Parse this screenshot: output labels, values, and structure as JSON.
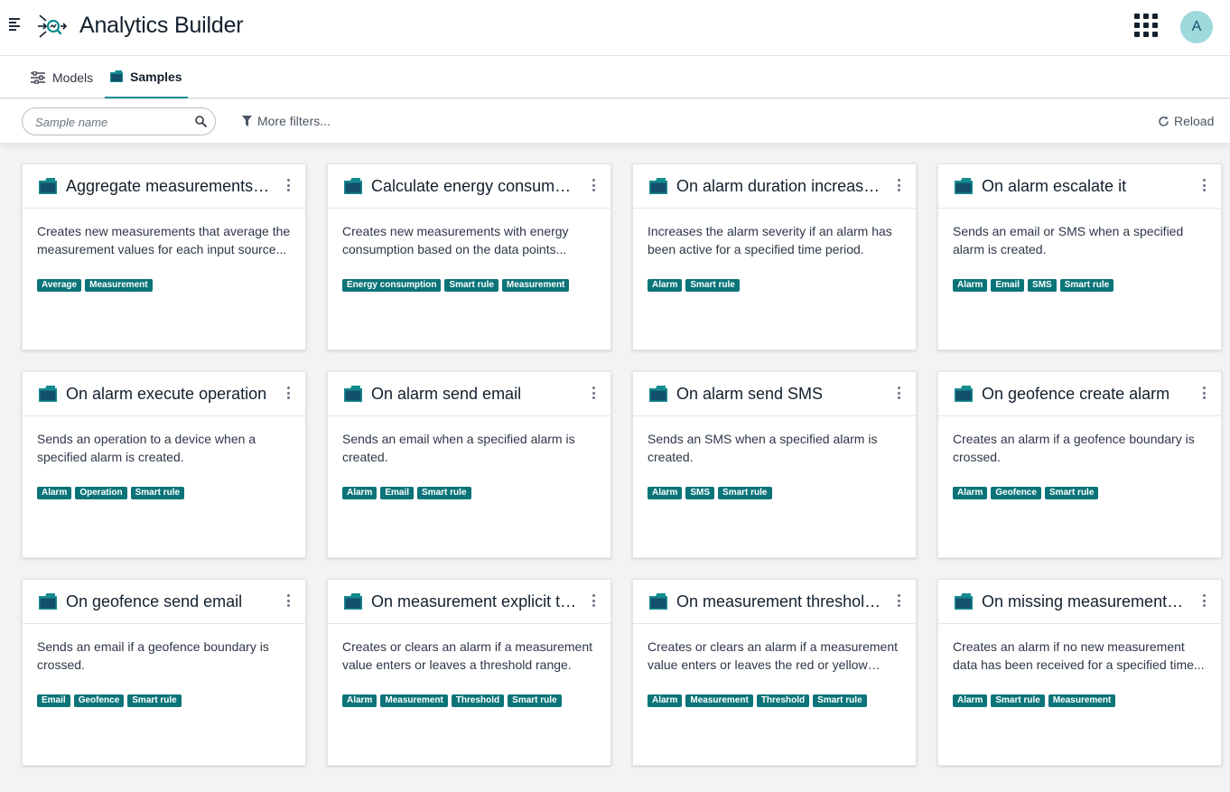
{
  "app": {
    "title": "Analytics Builder",
    "avatar_initial": "A"
  },
  "tabs": [
    {
      "label": "Models"
    },
    {
      "label": "Samples"
    }
  ],
  "filters": {
    "search_placeholder": "Sample name",
    "more_filters": "More filters...",
    "reload": "Reload"
  },
  "colors": {
    "accent": "#148b8f",
    "tag": "#0b7479",
    "avatar": "#9ed9db"
  },
  "cards": [
    {
      "title": "Aggregate measurements over time",
      "desc": "Creates new measurements that average the measurement values for each input source...",
      "tags": [
        "Average",
        "Measurement"
      ]
    },
    {
      "title": "Calculate energy consumption",
      "desc": "Creates new measurements with energy consumption based on the data points...",
      "tags": [
        "Energy consumption",
        "Smart rule",
        "Measurement"
      ]
    },
    {
      "title": "On alarm duration increase severity",
      "desc": "Increases the alarm severity if an alarm has been active for a specified time period.",
      "tags": [
        "Alarm",
        "Smart rule"
      ]
    },
    {
      "title": "On alarm escalate it",
      "desc": "Sends an email or SMS when a specified alarm is created.",
      "tags": [
        "Alarm",
        "Email",
        "SMS",
        "Smart rule"
      ]
    },
    {
      "title": "On alarm execute operation",
      "desc": "Sends an operation to a device when a specified alarm is created.",
      "tags": [
        "Alarm",
        "Operation",
        "Smart rule"
      ]
    },
    {
      "title": "On alarm send email",
      "desc": "Sends an email when a specified alarm is created.",
      "tags": [
        "Alarm",
        "Email",
        "Smart rule"
      ]
    },
    {
      "title": "On alarm send SMS",
      "desc": "Sends an SMS when a specified alarm is created.",
      "tags": [
        "Alarm",
        "SMS",
        "Smart rule"
      ]
    },
    {
      "title": "On geofence create alarm",
      "desc": "Creates an alarm if a geofence boundary is crossed.",
      "tags": [
        "Alarm",
        "Geofence",
        "Smart rule"
      ]
    },
    {
      "title": "On geofence send email",
      "desc": "Sends an email if a geofence boundary is crossed.",
      "tags": [
        "Email",
        "Geofence",
        "Smart rule"
      ]
    },
    {
      "title": "On measurement explicit threshold create alarm",
      "desc": "Creates or clears an alarm if a measurement value enters or leaves a threshold range.",
      "tags": [
        "Alarm",
        "Measurement",
        "Threshold",
        "Smart rule"
      ]
    },
    {
      "title": "On measurement threshold create alarm",
      "desc": "Creates or clears an alarm if a measurement value enters or leaves the red or yellow range...",
      "tags": [
        "Alarm",
        "Measurement",
        "Threshold",
        "Smart rule"
      ]
    },
    {
      "title": "On missing measurements create alarm",
      "desc": "Creates an alarm if no new measurement data has been received for a specified time...",
      "tags": [
        "Alarm",
        "Smart rule",
        "Measurement"
      ]
    }
  ]
}
